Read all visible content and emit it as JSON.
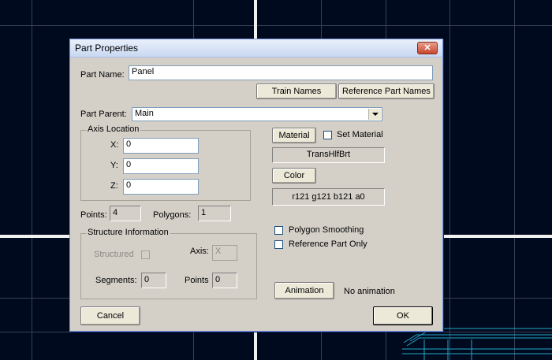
{
  "dialog": {
    "title": "Part Properties",
    "close_glyph": "✕",
    "part_name_label": "Part Name:",
    "part_name_value": "Panel",
    "train_names_button": "Train Names",
    "reference_part_names_button": "Reference Part Names",
    "part_parent_label": "Part Parent:",
    "part_parent_value": "Main",
    "axis_location": {
      "legend": "Axis Location",
      "x_label": "X:",
      "x_value": "0",
      "y_label": "Y:",
      "y_value": "0",
      "z_label": "Z:",
      "z_value": "0"
    },
    "material_button": "Material",
    "set_material_label": "Set Material",
    "set_material_checked": false,
    "material_value": "TransHlfBrt",
    "color_button": "Color",
    "color_value": "r121 g121 b121 a0",
    "points_label": "Points:",
    "points_value": "4",
    "polygons_label": "Polygons:",
    "polygons_value": "1",
    "polygon_smoothing_label": "Polygon Smoothing",
    "polygon_smoothing_checked": false,
    "reference_part_only_label": "Reference Part Only",
    "reference_part_only_checked": false,
    "structure": {
      "legend": "Structure Information",
      "structured_label": "Structured",
      "axis_label": "Axis:",
      "axis_value": "X",
      "segments_label": "Segments:",
      "segments_value": "0",
      "points_label": "Points",
      "points_value": "0"
    },
    "animation_button": "Animation",
    "animation_status": "No animation",
    "cancel_button": "Cancel",
    "ok_button": "OK"
  },
  "colors": {
    "viewport_bg": "#000a1e",
    "dialog_bg": "#d4d0c8",
    "close_button": "#c8452c"
  }
}
